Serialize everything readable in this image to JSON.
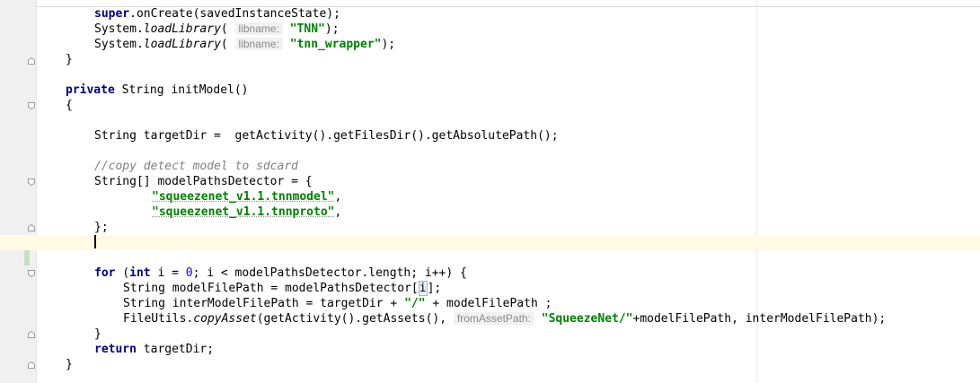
{
  "editor": {
    "language": "Java",
    "colors": {
      "keyword": "#000080",
      "string": "#008000",
      "number": "#0000ff",
      "comment": "#808080",
      "hint": "#8a8a8a",
      "current_line": "#fffae3",
      "gutter": "#f0f0f0"
    },
    "lines": [
      {
        "a": "super",
        "b": ".onCreate(savedInstanceState);"
      },
      {
        "a": "System.",
        "b": "loadLibrary",
        "c": "( ",
        "hint": "libname:",
        "str": "\"TNN\"",
        "d": ");"
      },
      {
        "a": "System.",
        "b": "loadLibrary",
        "c": "( ",
        "hint": "libname:",
        "str": "\"tnn_wrapper\"",
        "d": ");"
      },
      {
        "a": "}"
      },
      {
        "a": ""
      },
      {
        "a": "private",
        "b": " String initModel()"
      },
      {
        "a": "{"
      },
      {
        "a": ""
      },
      {
        "a": "String targetDir =  getActivity().getFilesDir().getAbsolutePath();"
      },
      {
        "a": ""
      },
      {
        "a": "//copy detect model to sdcard"
      },
      {
        "a": "String[] modelPathsDetector = {"
      },
      {
        "a": "\"squeezenet_v1.1.tnnmodel\"",
        "b": ","
      },
      {
        "a": "\"squeezenet_v1.1.tnnproto\"",
        "b": ","
      },
      {
        "a": "};"
      },
      {
        "a": ""
      },
      {
        "a": ""
      },
      {
        "a": ""
      },
      {
        "a": "for",
        "b": " (",
        "c": "int",
        "d": " i = ",
        "e": "0",
        "f": "; i < modelPathsDetector.length; i++) {"
      },
      {
        "a": "String modelFilePath = modelPathsDetector[",
        "b": "i",
        "c": "];"
      },
      {
        "a": "String interModelFilePath = targetDir + ",
        "str": "\"/\"",
        "b": " + modelFilePath ;"
      },
      {
        "a": "FileUtils.",
        "b": "copyAsset",
        "c": "(getActivity().getAssets(), ",
        "hint": "fromAssetPath:",
        "str": "\"SqueezeNet/\"",
        "d": "+modelFilePath, interModelFilePath);"
      },
      {
        "a": "}"
      },
      {
        "a": "return",
        "b": " targetDir;"
      },
      {
        "a": "}"
      }
    ]
  }
}
